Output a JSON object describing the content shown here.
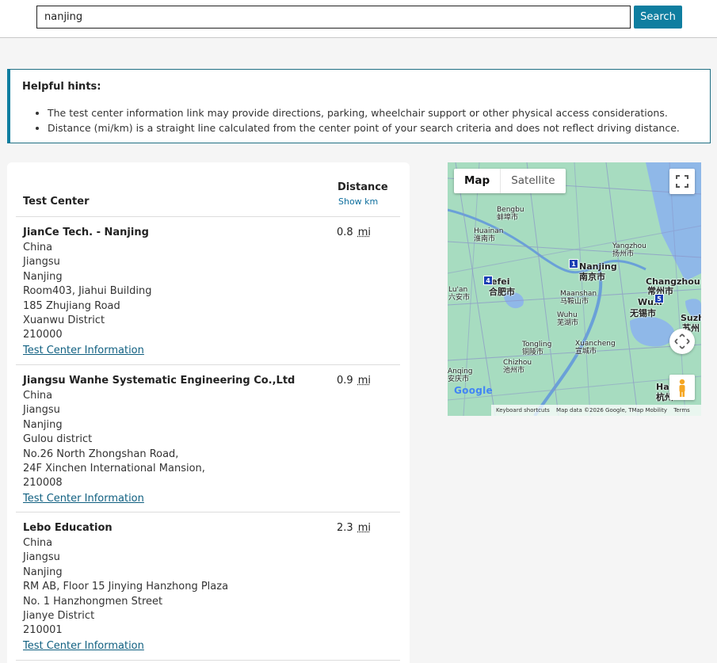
{
  "search": {
    "value": "nanjing",
    "button_label": "Search"
  },
  "hints": {
    "title": "Helpful hints:",
    "items": [
      "The test center information link may provide directions, parking, wheelchair support or other physical access considerations.",
      "Distance (mi/km) is a straight line calculated from the center point of your search criteria and does not reflect driving distance."
    ]
  },
  "results": {
    "col_test_center": "Test Center",
    "col_distance": "Distance",
    "show_km": "Show km",
    "link_label": "Test Center Information",
    "rows": [
      {
        "name": "JianCe Tech. - Nanjing",
        "distance": "0.8",
        "unit": "mi",
        "address": [
          "China",
          "Jiangsu",
          "Nanjing",
          "Room403, Jiahui Building",
          "185 Zhujiang Road",
          "Xuanwu District",
          "210000"
        ]
      },
      {
        "name": "Jiangsu Wanhe Systematic Engineering Co.,Ltd",
        "distance": "0.9",
        "unit": "mi",
        "address": [
          "China",
          "Jiangsu",
          "Nanjing",
          "Gulou district",
          "No.26 North Zhongshan Road,",
          "24F Xinchen International Mansion,",
          "210008"
        ]
      },
      {
        "name": "Lebo Education",
        "distance": "2.3",
        "unit": "mi",
        "address": [
          "China",
          "Jiangsu",
          "Nanjing",
          "RM AB, Floor 15 Jinying Hanzhong Plaza",
          "No. 1 Hanzhongmen Street",
          "Jianye District",
          "210001"
        ]
      }
    ]
  },
  "map": {
    "type_map": "Map",
    "type_satellite": "Satellite",
    "footer": {
      "shortcuts": "Keyboard shortcuts",
      "data": "Map data ©2026 Google, TMap Mobility",
      "terms": "Terms"
    },
    "logo": "Google",
    "labels": {
      "huaian": "Huaian",
      "huaian_cn": "淮安市",
      "bengbu": "Bengbu",
      "bengbu_cn": "蚌埠市",
      "huainan": "Huainan",
      "huainan_cn": "淮南市",
      "yangzhou": "Yangzhou",
      "yangzhou_cn": "扬州市",
      "nanjing": "Nanjing",
      "nanjing_cn": "南京市",
      "hefei": "efei",
      "hefei_cn": "合肥市",
      "luan": "Lu'an",
      "luan_cn": "六安市",
      "maanshan": "Maanshan",
      "maanshan_cn": "马鞍山市",
      "changzhou": "Changzhou",
      "changzhou_cn": "常州市",
      "wuxi": "Wuxi",
      "wuxi_cn": "无锡市",
      "wuhu": "Wuhu",
      "wuhu_cn": "芜湖市",
      "tongling": "Tongling",
      "tongling_cn": "铜陵市",
      "xuancheng": "Xuancheng",
      "xuancheng_cn": "宣城市",
      "chizhou": "Chizhou",
      "chizhou_cn": "池州市",
      "anqing": "Anqing",
      "anqing_cn": "安庆市",
      "suzhou": "Suzh",
      "suzhou_cn": "苏州",
      "hangzhou": "Ha",
      "hangzhou_cn": "杭州"
    },
    "markers": [
      "1",
      "4",
      "5"
    ]
  },
  "colors": {
    "accent": "#0f7ea0",
    "link": "#0f5f80",
    "map_land": "#a7dcc0",
    "map_water": "#8fb8e8",
    "marker": "#1a3fb3"
  }
}
